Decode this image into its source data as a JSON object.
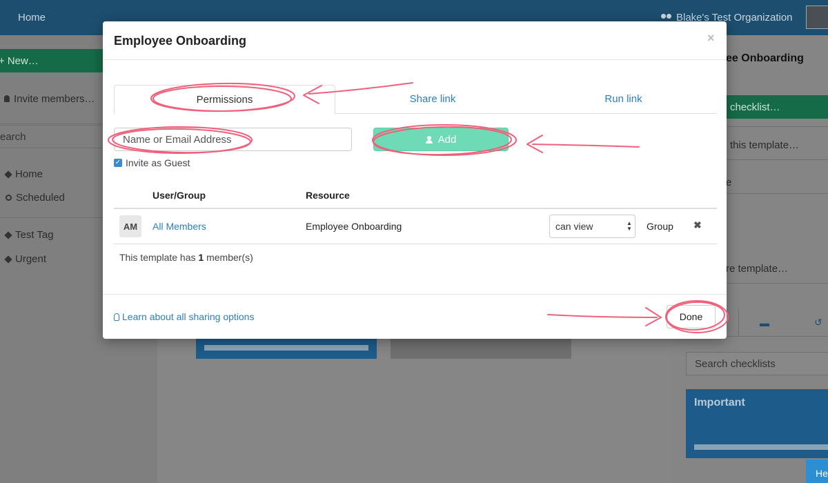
{
  "topbar": {
    "home": "Home",
    "org": "Blake's Test Organization"
  },
  "sidebar": {
    "new": "New…",
    "invite": "Invite members…",
    "search": "earch",
    "items": [
      {
        "label": "Home",
        "icon": "home-icon"
      },
      {
        "label": "Scheduled",
        "icon": "clock-icon"
      },
      {
        "label": "Test Tag",
        "icon": "tag-icon"
      },
      {
        "label": "Urgent",
        "icon": "tag-icon"
      }
    ]
  },
  "right_panel": {
    "title": "ee Onboarding",
    "green_button": "checklist…",
    "items": [
      "this template…",
      "e",
      "re template…"
    ],
    "search": "Search checklists",
    "important": "Important",
    "help": "He"
  },
  "modal": {
    "title": "Employee Onboarding",
    "close": "×",
    "tabs": [
      {
        "label": "Permissions",
        "active": true
      },
      {
        "label": "Share link",
        "active": false
      },
      {
        "label": "Run link",
        "active": false
      }
    ],
    "email_placeholder": "Name or Email Address",
    "add_label": "Add",
    "guest_label": "Invite as Guest",
    "guest_checked": true,
    "columns": {
      "user": "User/Group",
      "resource": "Resource"
    },
    "rows": [
      {
        "initials": "AM",
        "name": "All Members",
        "resource": "Employee Onboarding",
        "permission": "can view",
        "type": "Group"
      }
    ],
    "summary_prefix": "This template has",
    "summary_count": "1",
    "summary_suffix": "member(s)",
    "learn_link": "Learn about all sharing options",
    "done_label": "Done"
  },
  "colors": {
    "accent": "#2a7fc1",
    "add_button": "#6edbb6",
    "annotation": "#f0607a"
  }
}
